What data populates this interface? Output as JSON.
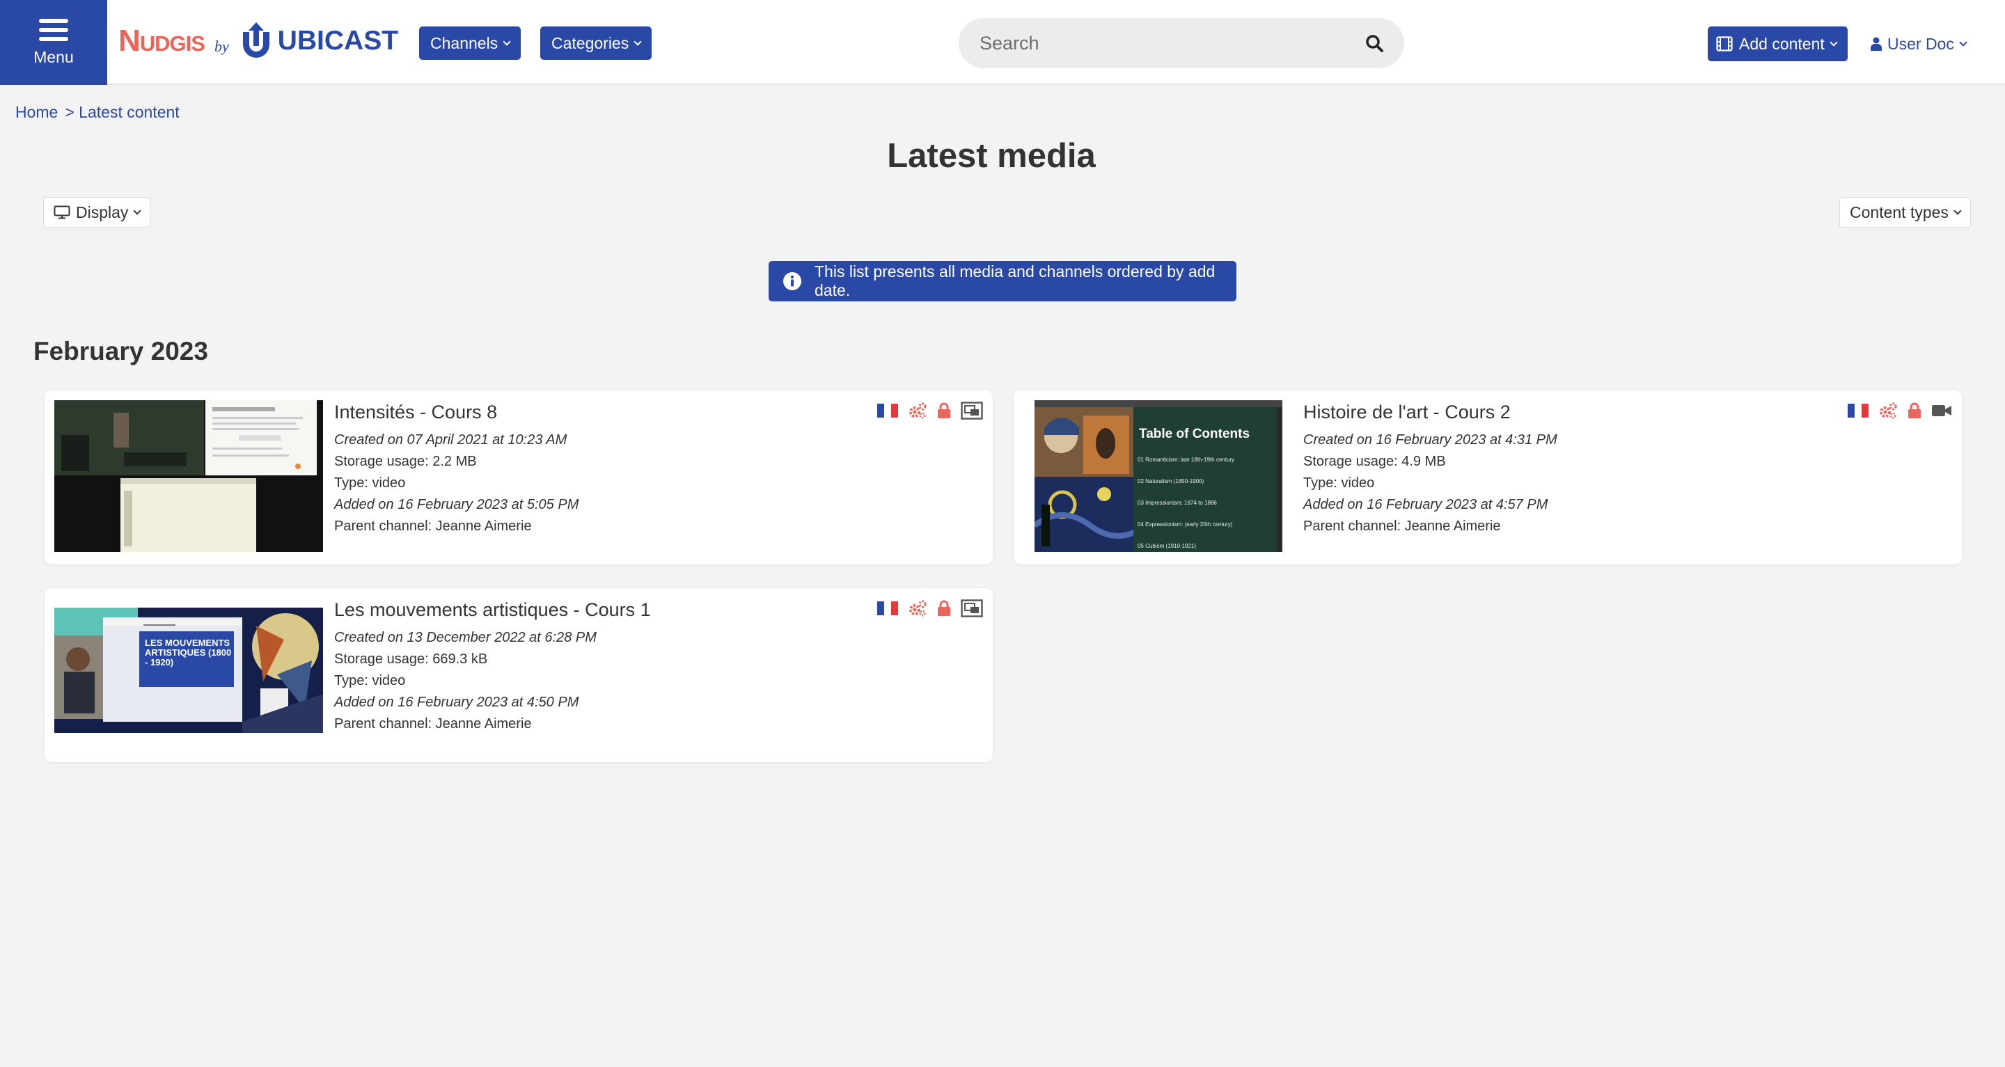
{
  "header": {
    "menu_label": "Menu",
    "logo": {
      "brand": "Nudgis",
      "by": "by",
      "company": "UBICAST"
    },
    "nav": {
      "channels": "Channels",
      "categories": "Categories"
    },
    "search_placeholder": "Search",
    "add_content": "Add content",
    "user": "User Doc"
  },
  "breadcrumb": {
    "home": "Home",
    "current": "> Latest content"
  },
  "page_title": "Latest media",
  "controls": {
    "display": "Display",
    "content_types": "Content types"
  },
  "info_banner": "This list presents all media and channels ordered by add date.",
  "section": "February 2023",
  "media": [
    {
      "title": "Intensités - Cours 8",
      "created": "Created on 07 April 2021 at 10:23 AM",
      "storage": "Storage usage: 2.2 MB",
      "type": "Type: video",
      "added": "Added on 16 February 2023 at 5:05 PM",
      "parent": "Parent channel: Jeanne Aimerie",
      "icons": [
        "flag-fr-icon",
        "settings-icon",
        "lock-icon",
        "layout-icon"
      ]
    },
    {
      "title": "Histoire de l'art - Cours 2",
      "created": "Created on 16 February 2023 at 4:31 PM",
      "storage": "Storage usage: 4.9 MB",
      "type": "Type: video",
      "added": "Added on 16 February 2023 at 4:57 PM",
      "parent": "Parent channel: Jeanne Aimerie",
      "thumb_text": {
        "heading": "Table of Contents",
        "items": [
          "01 Romanticism: late 18th-19th century",
          "02 Naturalism (1850-1900)",
          "03 Impressionism: 1874 to 1886",
          "04 Expressionism: (early 20th century)",
          "05 Cubism (1910-1921)"
        ]
      },
      "icons": [
        "flag-fr-icon",
        "settings-icon",
        "lock-icon",
        "video-camera-icon"
      ]
    },
    {
      "title": "Les mouvements artistiques - Cours 1",
      "created": "Created on 13 December 2022 at 6:28 PM",
      "storage": "Storage usage: 669.3 kB",
      "type": "Type: video",
      "added": "Added on 16 February 2023 at 4:50 PM",
      "parent": "Parent channel: Jeanne Aimerie",
      "thumb_text": {
        "heading": "LES MOUVEMENTS ARTISTIQUES (1800 - 1920)"
      },
      "icons": [
        "flag-fr-icon",
        "settings-icon",
        "lock-icon",
        "layout-icon"
      ]
    }
  ],
  "colors": {
    "primary": "#2a48a6",
    "accent": "#e8665c",
    "background": "#f3f3f3"
  }
}
